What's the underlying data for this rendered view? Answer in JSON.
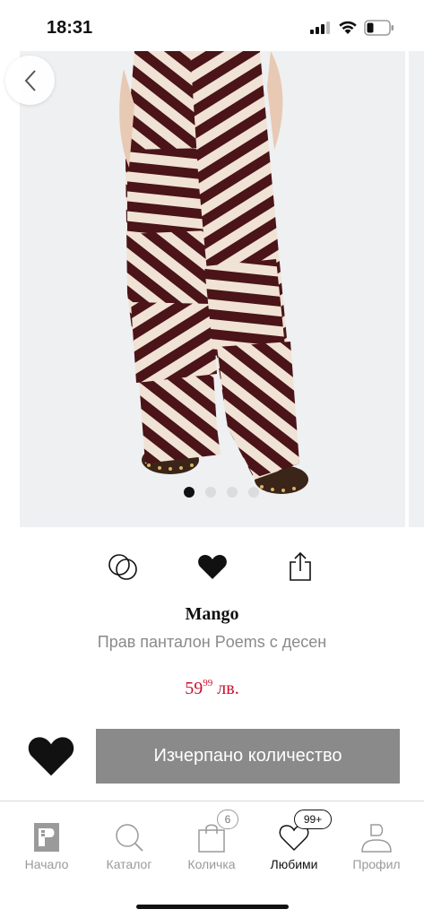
{
  "status_bar": {
    "time": "18:31"
  },
  "gallery": {
    "image_alt": "Прав панталон Poems с десен",
    "slide_count": 4,
    "active_slide": 1
  },
  "actions": {
    "compare_icon": "compare-circles-icon",
    "favorite_icon": "heart-filled-icon",
    "share_icon": "share-icon"
  },
  "product": {
    "brand": "Mango",
    "name": "Прав панталон Poems с десен",
    "price_whole": "59",
    "price_fraction": "99",
    "currency": "лв.",
    "price_color": "#c8102e"
  },
  "buy": {
    "button_label": "Изчерпано количество",
    "button_color": "#8a8a8a"
  },
  "tab_bar": {
    "items": [
      {
        "label": "Начало",
        "icon": "home-logo-icon"
      },
      {
        "label": "Каталог",
        "icon": "search-icon"
      },
      {
        "label": "Количка",
        "icon": "bag-icon",
        "badge": "6"
      },
      {
        "label": "Любими",
        "icon": "heart-outline-icon",
        "badge": "99+",
        "active": true
      },
      {
        "label": "Профил",
        "icon": "user-icon"
      }
    ]
  }
}
